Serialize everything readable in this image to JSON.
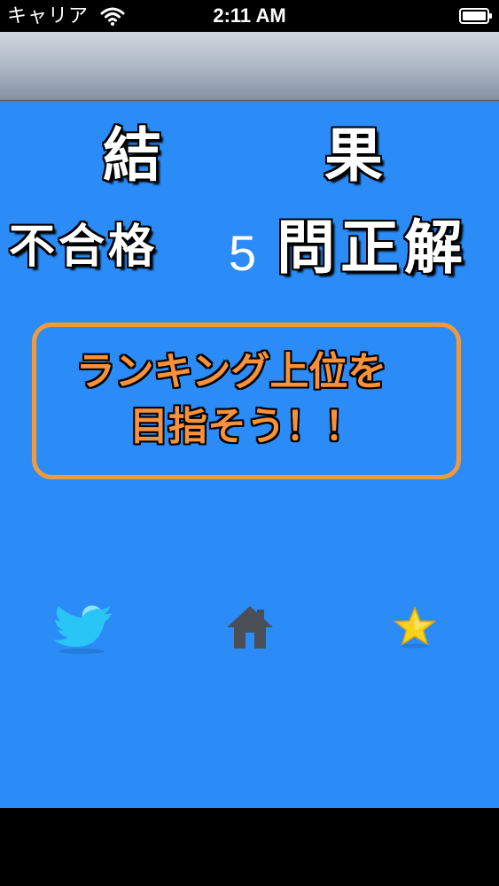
{
  "status_bar": {
    "carrier": "キャリア",
    "time": "2:11 AM"
  },
  "result": {
    "title_left": "結",
    "title_right": "果",
    "judgement": "不合格",
    "correct_count": "5",
    "correct_unit": "問正解"
  },
  "message": {
    "line1": "ランキング上位を",
    "line2": "目指そう！！"
  },
  "icons": {
    "wifi": "wifi-icon",
    "battery": "battery-icon",
    "twitter": "twitter-bird-icon",
    "home": "home-icon",
    "star": "star-icon"
  },
  "colors": {
    "background": "#2b8cf8",
    "message_text": "#f7913a",
    "message_border": "#f4993a",
    "twitter": "#29c5f6",
    "home": "#4a4f57",
    "star": "#f9d21e"
  }
}
